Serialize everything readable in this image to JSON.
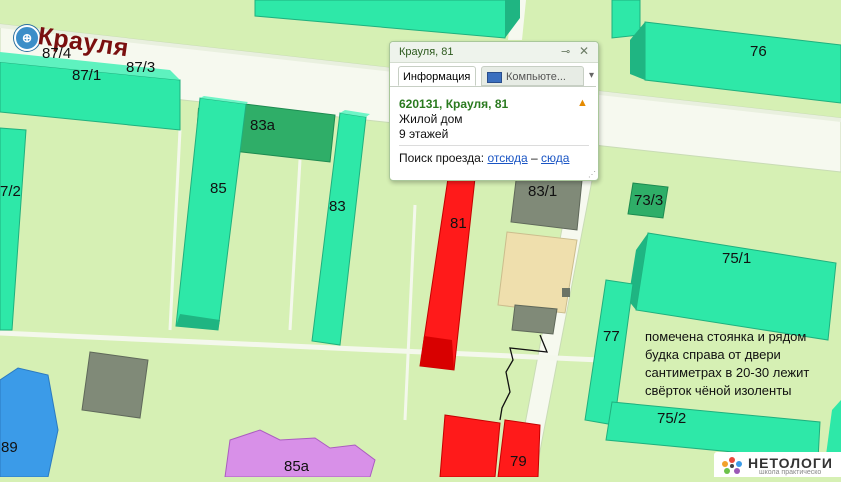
{
  "map": {
    "street_name": "Крауля",
    "bus_stop_icon": "bus-stop-icon",
    "building_labels": [
      "87/4",
      "87/1",
      "87/3",
      "83а",
      "85",
      "83",
      "81",
      "83/1",
      "73/3",
      "76",
      "75/1",
      "77",
      "75/2",
      "79",
      "89",
      "85а",
      "7/2"
    ],
    "note": "помечена стоянка и рядом будка справа от двери сантиметрах в 20-30 лежит свёрток чёной изоленты",
    "colors": {
      "ground": "#d6f0b4",
      "road": "#f6f9ef",
      "residential_building": "#2ee8a8",
      "selected_building": "#ff1a1a",
      "garage": "#808a78",
      "parking_area": "#efdfad",
      "school_building": "#d890e8",
      "blue_building": "#3b9be8"
    }
  },
  "popup": {
    "title": "Крауля, 81",
    "pin_icon": "pin-icon",
    "close_icon": "close-icon",
    "tabs": [
      {
        "label": "Информация",
        "active": true
      },
      {
        "label": "Компьюте...",
        "active": false,
        "icon": "computer-icon"
      }
    ],
    "more_icon": "chevron-down-icon",
    "address": "620131, Крауля, 81",
    "warning_icon": "warning-icon",
    "type": "Жилой дом",
    "floors": "9 этажей",
    "route_label": "Поиск проезда:",
    "route_from": "отсюда",
    "route_dash": "–",
    "route_to": "сюда"
  },
  "logo": {
    "text": "НЕТОЛОГИ",
    "subtitle": "школа практическо"
  }
}
